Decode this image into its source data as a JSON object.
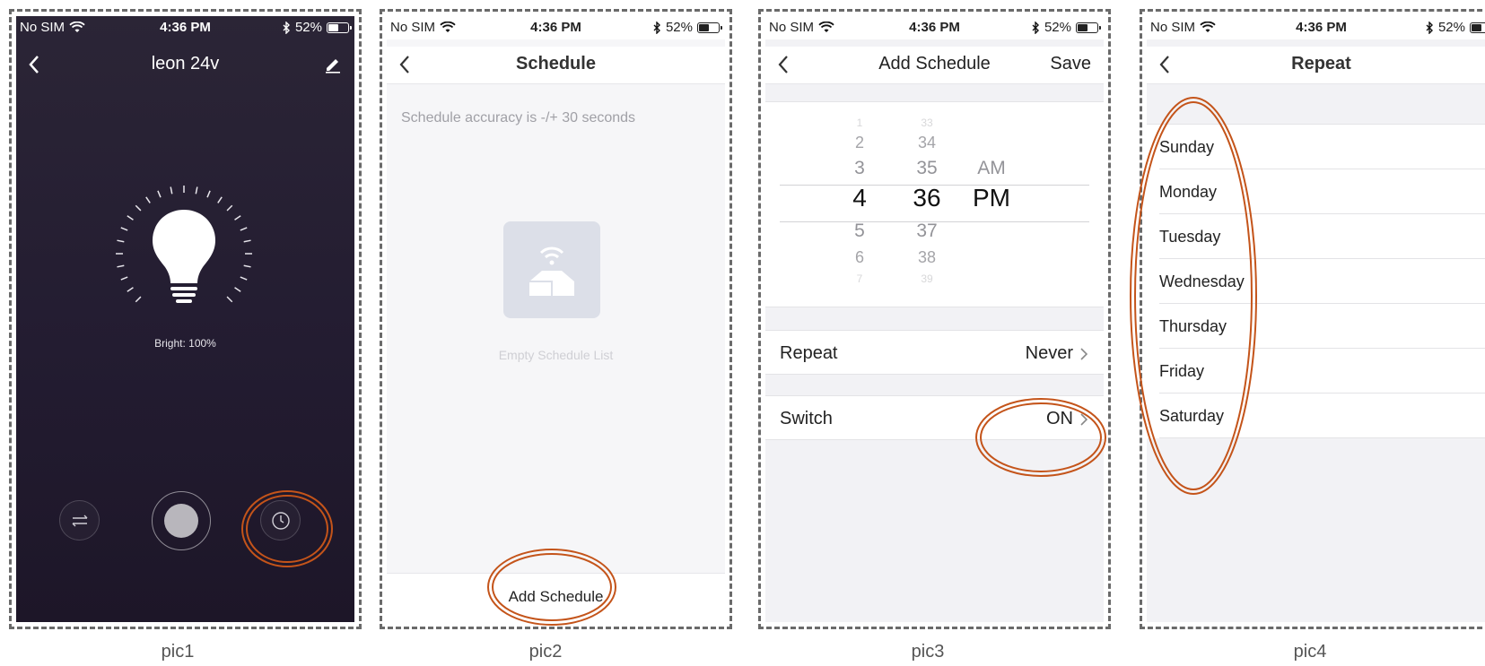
{
  "status_bar": {
    "carrier": "No SIM",
    "time": "4:36 PM",
    "battery": "52%"
  },
  "pic1": {
    "title": "leon 24v",
    "brightness_text": "Bright: 100%",
    "icons": [
      "back-icon",
      "edit-icon",
      "sliders-icon",
      "power-knob",
      "clock-icon"
    ]
  },
  "pic2": {
    "title": "Schedule",
    "accuracy_note": "Schedule accuracy is -/+ 30 seconds",
    "empty_text": "Empty Schedule List",
    "add_button": "Add Schedule"
  },
  "pic3": {
    "title": "Add Schedule",
    "save_label": "Save",
    "picker": {
      "hours": [
        "1",
        "2",
        "3",
        "4",
        "5",
        "6",
        "7"
      ],
      "minutes": [
        "33",
        "34",
        "35",
        "36",
        "37",
        "38",
        "39"
      ],
      "periods": [
        "AM",
        "PM"
      ],
      "selected": {
        "hour": "4",
        "minute": "36",
        "period": "PM"
      }
    },
    "repeat": {
      "label": "Repeat",
      "value": "Never"
    },
    "switch": {
      "label": "Switch",
      "value": "ON"
    }
  },
  "pic4": {
    "title": "Repeat",
    "days": [
      "Sunday",
      "Monday",
      "Tuesday",
      "Wednesday",
      "Thursday",
      "Friday",
      "Saturday"
    ]
  },
  "captions": [
    "pic1",
    "pic2",
    "pic3",
    "pic4"
  ],
  "colors": {
    "highlight": "#c4541a",
    "dark_bg": "#231c31",
    "frame_border": "#6a6a6a"
  }
}
